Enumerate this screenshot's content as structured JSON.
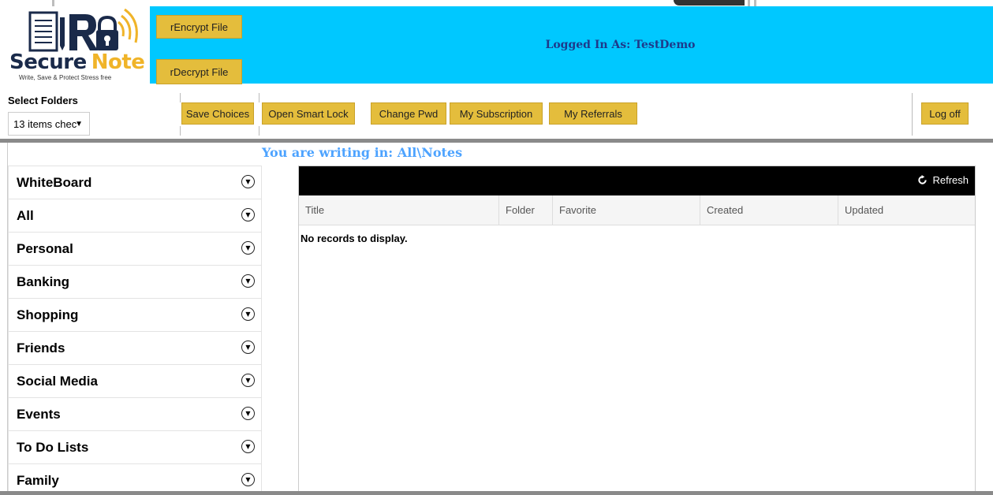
{
  "app": {
    "logo_brand_1": "Secure",
    "logo_brand_2": "Note",
    "logo_tagline": "Write, Save & Protect Stress free",
    "encrypt_label": "rEncrypt File",
    "decrypt_label": "rDecrypt File",
    "logged_in": "Logged In As: TestDemo"
  },
  "toolbar": {
    "select_folders_label": "Select Folders",
    "select_value": "13 items chec",
    "buttons": {
      "save_choices": "Save Choices",
      "open_smart_lock": "Open Smart Lock",
      "change_pwd": "Change Pwd",
      "my_subscription": "My Subscription",
      "my_referrals": "My Referrals",
      "log_off": "Log off"
    }
  },
  "writing_in": "You are writing in:  All\\Notes",
  "folders": [
    "WhiteBoard",
    "All",
    "Personal",
    "Banking",
    "Shopping",
    "Friends",
    "Social Media",
    "Events",
    "To Do Lists",
    "Family"
  ],
  "grid": {
    "refresh_label": "Refresh",
    "columns": [
      "Title",
      "Folder",
      "Favorite",
      "Created",
      "Updated"
    ],
    "empty_message": "No records to display."
  },
  "colors": {
    "banner": "#00c8ff",
    "button": "#e4bd3c",
    "brand_navy": "#1a2a4a",
    "brand_gold": "#f0b429",
    "writing_in": "#4da3ff"
  },
  "icons": [
    "notepad-lock-logo",
    "chevron-down-circle-icon",
    "refresh-icon",
    "dropdown-arrow-icon"
  ]
}
